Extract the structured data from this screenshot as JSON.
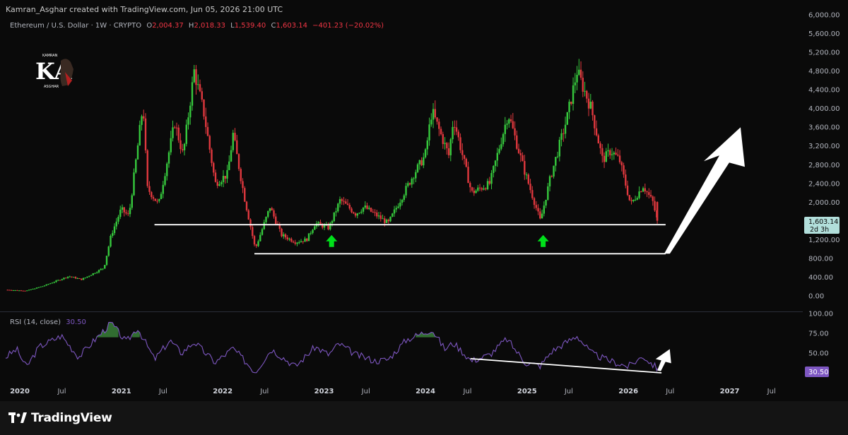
{
  "credit": "Kamran_Asghar created with TradingView.com, Jun 05, 2026 21:00 UTC",
  "header": {
    "symbol": "Ethereum / U.S. Dollar · 1W · CRYPTO",
    "o_label": "O",
    "o_value": "2,004.37",
    "h_label": "H",
    "h_value": "2,018.33",
    "l_label": "L",
    "l_value": "1,539.40",
    "c_label": "C",
    "c_value": "1,603.14",
    "change": "−401.23 (−20.02%)"
  },
  "logo": {
    "letters": "KA",
    "small_top": "KAMRAN",
    "small_bottom": "ASGHAR"
  },
  "price_axis": [
    "6,000.00",
    "5,600.00",
    "5,200.00",
    "4,800.00",
    "4,400.00",
    "4,000.00",
    "3,600.00",
    "3,200.00",
    "2,800.00",
    "2,400.00",
    "2,000.00",
    "1,600.00",
    "1,200.00",
    "800.00",
    "400.00",
    "0.00"
  ],
  "price_tag": {
    "value": "1,603.14",
    "countdown": "2d 3h"
  },
  "rsi": {
    "label": "RSI (14, close)",
    "value": "30.50",
    "axis": [
      "100.00",
      "75.00",
      "50.00",
      "25.00"
    ]
  },
  "time_axis": [
    {
      "label": "2020",
      "bold": true
    },
    {
      "label": "Jul",
      "bold": false
    },
    {
      "label": "2021",
      "bold": true
    },
    {
      "label": "Jul",
      "bold": false
    },
    {
      "label": "2022",
      "bold": true
    },
    {
      "label": "Jul",
      "bold": false
    },
    {
      "label": "2023",
      "bold": true
    },
    {
      "label": "Jul",
      "bold": false
    },
    {
      "label": "2024",
      "bold": true
    },
    {
      "label": "Jul",
      "bold": false
    },
    {
      "label": "2025",
      "bold": true
    },
    {
      "label": "Jul",
      "bold": false
    },
    {
      "label": "2026",
      "bold": true
    },
    {
      "label": "Jul",
      "bold": false
    },
    {
      "label": "2027",
      "bold": true
    },
    {
      "label": "Jul",
      "bold": false
    }
  ],
  "brand": "TradingView",
  "colors": {
    "up": "#26a69a",
    "up_bright": "#3fd63f",
    "down": "#e53935",
    "rsi": "#7e57c2",
    "arrow_green": "#00e01a",
    "line": "#ffffff",
    "bg": "#0a0a0a"
  },
  "chart_data": {
    "type": "candlestick",
    "title": "Ethereum / U.S. Dollar · 1W · CRYPTO",
    "interval": "1W",
    "x_range": [
      "2020-01-01",
      "2027-12-31"
    ],
    "ylim": [
      0,
      6000
    ],
    "price_path": [
      [
        "2020-01-01",
        130
      ],
      [
        "2020-03-15",
        110
      ],
      [
        "2020-05-15",
        210
      ],
      [
        "2020-08-15",
        420
      ],
      [
        "2020-10-01",
        350
      ],
      [
        "2020-12-20",
        600
      ],
      [
        "2021-01-15",
        1300
      ],
      [
        "2021-02-20",
        1850
      ],
      [
        "2021-03-20",
        1700
      ],
      [
        "2021-05-10",
        4100
      ],
      [
        "2021-05-25",
        2300
      ],
      [
        "2021-07-05",
        1950
      ],
      [
        "2021-09-01",
        3700
      ],
      [
        "2021-10-01",
        3000
      ],
      [
        "2021-11-10",
        4800
      ],
      [
        "2021-12-15",
        3900
      ],
      [
        "2022-01-25",
        2400
      ],
      [
        "2022-03-10",
        2600
      ],
      [
        "2022-03-30",
        3450
      ],
      [
        "2022-05-10",
        2100
      ],
      [
        "2022-06-18",
        1000
      ],
      [
        "2022-08-10",
        1900
      ],
      [
        "2022-09-20",
        1300
      ],
      [
        "2022-11-10",
        1150
      ],
      [
        "2022-12-20",
        1200
      ],
      [
        "2023-01-20",
        1550
      ],
      [
        "2023-03-10",
        1450
      ],
      [
        "2023-04-20",
        2050
      ],
      [
        "2023-06-15",
        1750
      ],
      [
        "2023-07-15",
        1900
      ],
      [
        "2023-10-10",
        1550
      ],
      [
        "2023-12-10",
        2250
      ],
      [
        "2024-01-10",
        2600
      ],
      [
        "2024-02-20",
        3000
      ],
      [
        "2024-03-15",
        3950
      ],
      [
        "2024-05-15",
        3000
      ],
      [
        "2024-06-01",
        3800
      ],
      [
        "2024-08-05",
        2200
      ],
      [
        "2024-10-10",
        2400
      ],
      [
        "2024-12-15",
        3900
      ],
      [
        "2025-02-10",
        2700
      ],
      [
        "2025-04-10",
        1600
      ],
      [
        "2025-05-15",
        2500
      ],
      [
        "2025-07-15",
        3800
      ],
      [
        "2025-08-20",
        4800
      ],
      [
        "2025-10-10",
        4000
      ],
      [
        "2025-11-20",
        2900
      ],
      [
        "2025-12-20",
        3100
      ],
      [
        "2026-01-20",
        2900
      ],
      [
        "2026-03-01",
        1950
      ],
      [
        "2026-04-15",
        2350
      ],
      [
        "2026-05-20",
        2004
      ],
      [
        "2026-06-05",
        1603
      ]
    ],
    "last_candle": {
      "date": "2026-06-05",
      "open": 2004.37,
      "high": 2018.33,
      "low": 1539.4,
      "close": 1603.14,
      "change": -401.23,
      "change_pct": -20.02
    },
    "support_lines": [
      {
        "from": [
          "2021-06-20",
          1520
        ],
        "to": [
          "2026-07-05",
          1520
        ]
      },
      {
        "from": [
          "2022-06-15",
          900
        ],
        "to": [
          "2026-07-05",
          900
        ]
      }
    ],
    "up_arrows": [
      {
        "date": "2023-03-20",
        "price": 1150
      },
      {
        "date": "2025-04-20",
        "price": 1150
      }
    ],
    "projection_arrow": {
      "from": [
        "2026-07-05",
        900
      ],
      "to": [
        "2027-04-01",
        3600
      ]
    },
    "rsi": {
      "ylim": [
        0,
        100
      ],
      "values": [
        [
          "2020-01-01",
          45
        ],
        [
          "2020-02-10",
          55
        ],
        [
          "2020-03-15",
          32
        ],
        [
          "2020-05-01",
          58
        ],
        [
          "2020-07-20",
          72
        ],
        [
          "2020-09-20",
          45
        ],
        [
          "2020-11-20",
          68
        ],
        [
          "2021-01-15",
          88
        ],
        [
          "2021-03-10",
          64
        ],
        [
          "2021-04-20",
          82
        ],
        [
          "2021-06-20",
          42
        ],
        [
          "2021-08-15",
          66
        ],
        [
          "2021-09-25",
          50
        ],
        [
          "2021-11-10",
          64
        ],
        [
          "2022-01-25",
          38
        ],
        [
          "2022-03-30",
          56
        ],
        [
          "2022-06-18",
          26
        ],
        [
          "2022-08-15",
          55
        ],
        [
          "2022-11-10",
          33
        ],
        [
          "2023-01-20",
          58
        ],
        [
          "2023-03-10",
          48
        ],
        [
          "2023-04-15",
          62
        ],
        [
          "2023-06-15",
          48
        ],
        [
          "2023-08-25",
          40
        ],
        [
          "2023-10-10",
          42
        ],
        [
          "2023-12-15",
          67
        ],
        [
          "2024-03-15",
          80
        ],
        [
          "2024-05-01",
          55
        ],
        [
          "2024-06-01",
          63
        ],
        [
          "2024-08-05",
          40
        ],
        [
          "2024-10-10",
          48
        ],
        [
          "2024-12-10",
          68
        ],
        [
          "2025-02-15",
          38
        ],
        [
          "2025-04-10",
          34
        ],
        [
          "2025-05-20",
          52
        ],
        [
          "2025-08-20",
          72
        ],
        [
          "2025-10-10",
          50
        ],
        [
          "2025-12-01",
          42
        ],
        [
          "2026-02-20",
          33
        ],
        [
          "2026-04-15",
          46
        ],
        [
          "2026-06-05",
          30.5
        ]
      ],
      "divergence_line": {
        "from": [
          "2024-08-01",
          43
        ],
        "to": [
          "2026-06-05",
          25
        ]
      },
      "arrow": {
        "from": [
          "2026-06-05",
          28
        ],
        "to": [
          "2026-07-20",
          55
        ]
      }
    }
  }
}
